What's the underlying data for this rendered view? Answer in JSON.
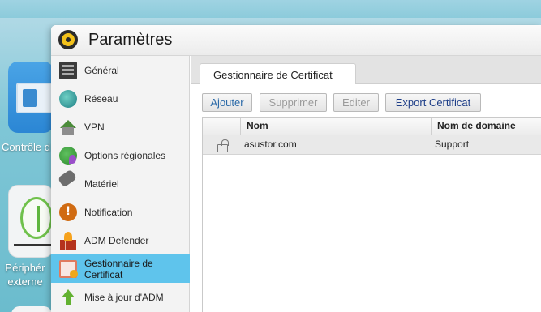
{
  "desktop": {
    "icons": [
      {
        "label": "Contrôle d"
      },
      {
        "label": "Périphér externe"
      }
    ]
  },
  "window": {
    "title": "Paramètres"
  },
  "sidebar": {
    "items": [
      {
        "label": "Général",
        "icon": "general-icon"
      },
      {
        "label": "Réseau",
        "icon": "globe-icon"
      },
      {
        "label": "VPN",
        "icon": "house-network-icon"
      },
      {
        "label": "Options régionales",
        "icon": "globe-pin-icon"
      },
      {
        "label": "Matériel",
        "icon": "hardware-icon"
      },
      {
        "label": "Notification",
        "icon": "alert-icon"
      },
      {
        "label": "ADM Defender",
        "icon": "firewall-icon"
      },
      {
        "label": "Gestionnaire de Certificat",
        "icon": "certificate-icon",
        "active": true
      },
      {
        "label": "Mise à jour d'ADM",
        "icon": "update-arrow-icon"
      }
    ]
  },
  "main": {
    "tab": "Gestionnaire de Certificat",
    "toolbar": {
      "add": "Ajouter",
      "delete": "Supprimer",
      "edit": "Editer",
      "export": "Export Certificat"
    },
    "table": {
      "columns": [
        "Nom",
        "Nom de domaine"
      ],
      "rows": [
        {
          "name": "asustor.com",
          "domain": "Support",
          "locked": false
        }
      ]
    }
  },
  "colors": {
    "active_item": "#5fc4ec",
    "button_text": "#2b6aa8",
    "disabled_text": "#9b9b9b"
  }
}
